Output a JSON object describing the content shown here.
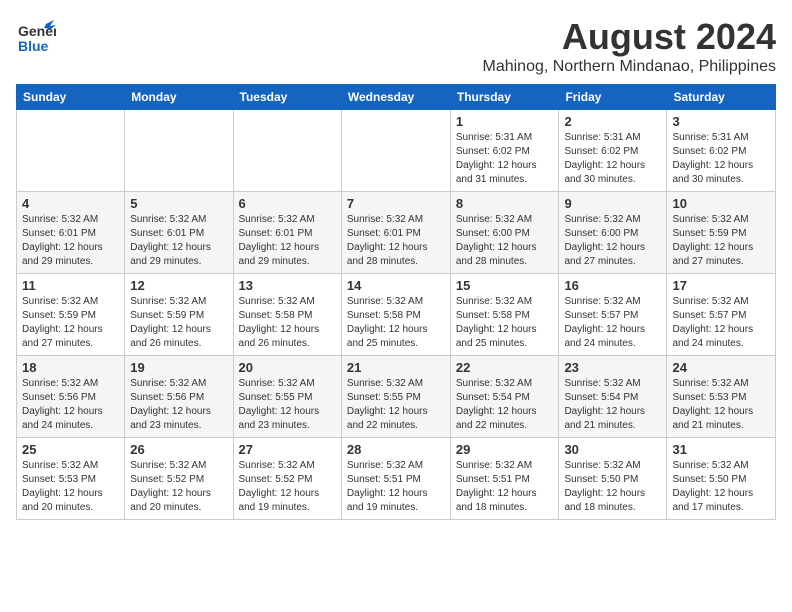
{
  "header": {
    "logo": {
      "general": "General",
      "blue": "Blue"
    },
    "title": "August 2024",
    "location": "Mahinog, Northern Mindanao, Philippines"
  },
  "weekdays": [
    "Sunday",
    "Monday",
    "Tuesday",
    "Wednesday",
    "Thursday",
    "Friday",
    "Saturday"
  ],
  "weeks": [
    [
      {
        "day": "",
        "info": ""
      },
      {
        "day": "",
        "info": ""
      },
      {
        "day": "",
        "info": ""
      },
      {
        "day": "",
        "info": ""
      },
      {
        "day": "1",
        "info": "Sunrise: 5:31 AM\nSunset: 6:02 PM\nDaylight: 12 hours\nand 31 minutes."
      },
      {
        "day": "2",
        "info": "Sunrise: 5:31 AM\nSunset: 6:02 PM\nDaylight: 12 hours\nand 30 minutes."
      },
      {
        "day": "3",
        "info": "Sunrise: 5:31 AM\nSunset: 6:02 PM\nDaylight: 12 hours\nand 30 minutes."
      }
    ],
    [
      {
        "day": "4",
        "info": "Sunrise: 5:32 AM\nSunset: 6:01 PM\nDaylight: 12 hours\nand 29 minutes."
      },
      {
        "day": "5",
        "info": "Sunrise: 5:32 AM\nSunset: 6:01 PM\nDaylight: 12 hours\nand 29 minutes."
      },
      {
        "day": "6",
        "info": "Sunrise: 5:32 AM\nSunset: 6:01 PM\nDaylight: 12 hours\nand 29 minutes."
      },
      {
        "day": "7",
        "info": "Sunrise: 5:32 AM\nSunset: 6:01 PM\nDaylight: 12 hours\nand 28 minutes."
      },
      {
        "day": "8",
        "info": "Sunrise: 5:32 AM\nSunset: 6:00 PM\nDaylight: 12 hours\nand 28 minutes."
      },
      {
        "day": "9",
        "info": "Sunrise: 5:32 AM\nSunset: 6:00 PM\nDaylight: 12 hours\nand 27 minutes."
      },
      {
        "day": "10",
        "info": "Sunrise: 5:32 AM\nSunset: 5:59 PM\nDaylight: 12 hours\nand 27 minutes."
      }
    ],
    [
      {
        "day": "11",
        "info": "Sunrise: 5:32 AM\nSunset: 5:59 PM\nDaylight: 12 hours\nand 27 minutes."
      },
      {
        "day": "12",
        "info": "Sunrise: 5:32 AM\nSunset: 5:59 PM\nDaylight: 12 hours\nand 26 minutes."
      },
      {
        "day": "13",
        "info": "Sunrise: 5:32 AM\nSunset: 5:58 PM\nDaylight: 12 hours\nand 26 minutes."
      },
      {
        "day": "14",
        "info": "Sunrise: 5:32 AM\nSunset: 5:58 PM\nDaylight: 12 hours\nand 25 minutes."
      },
      {
        "day": "15",
        "info": "Sunrise: 5:32 AM\nSunset: 5:58 PM\nDaylight: 12 hours\nand 25 minutes."
      },
      {
        "day": "16",
        "info": "Sunrise: 5:32 AM\nSunset: 5:57 PM\nDaylight: 12 hours\nand 24 minutes."
      },
      {
        "day": "17",
        "info": "Sunrise: 5:32 AM\nSunset: 5:57 PM\nDaylight: 12 hours\nand 24 minutes."
      }
    ],
    [
      {
        "day": "18",
        "info": "Sunrise: 5:32 AM\nSunset: 5:56 PM\nDaylight: 12 hours\nand 24 minutes."
      },
      {
        "day": "19",
        "info": "Sunrise: 5:32 AM\nSunset: 5:56 PM\nDaylight: 12 hours\nand 23 minutes."
      },
      {
        "day": "20",
        "info": "Sunrise: 5:32 AM\nSunset: 5:55 PM\nDaylight: 12 hours\nand 23 minutes."
      },
      {
        "day": "21",
        "info": "Sunrise: 5:32 AM\nSunset: 5:55 PM\nDaylight: 12 hours\nand 22 minutes."
      },
      {
        "day": "22",
        "info": "Sunrise: 5:32 AM\nSunset: 5:54 PM\nDaylight: 12 hours\nand 22 minutes."
      },
      {
        "day": "23",
        "info": "Sunrise: 5:32 AM\nSunset: 5:54 PM\nDaylight: 12 hours\nand 21 minutes."
      },
      {
        "day": "24",
        "info": "Sunrise: 5:32 AM\nSunset: 5:53 PM\nDaylight: 12 hours\nand 21 minutes."
      }
    ],
    [
      {
        "day": "25",
        "info": "Sunrise: 5:32 AM\nSunset: 5:53 PM\nDaylight: 12 hours\nand 20 minutes."
      },
      {
        "day": "26",
        "info": "Sunrise: 5:32 AM\nSunset: 5:52 PM\nDaylight: 12 hours\nand 20 minutes."
      },
      {
        "day": "27",
        "info": "Sunrise: 5:32 AM\nSunset: 5:52 PM\nDaylight: 12 hours\nand 19 minutes."
      },
      {
        "day": "28",
        "info": "Sunrise: 5:32 AM\nSunset: 5:51 PM\nDaylight: 12 hours\nand 19 minutes."
      },
      {
        "day": "29",
        "info": "Sunrise: 5:32 AM\nSunset: 5:51 PM\nDaylight: 12 hours\nand 18 minutes."
      },
      {
        "day": "30",
        "info": "Sunrise: 5:32 AM\nSunset: 5:50 PM\nDaylight: 12 hours\nand 18 minutes."
      },
      {
        "day": "31",
        "info": "Sunrise: 5:32 AM\nSunset: 5:50 PM\nDaylight: 12 hours\nand 17 minutes."
      }
    ]
  ]
}
